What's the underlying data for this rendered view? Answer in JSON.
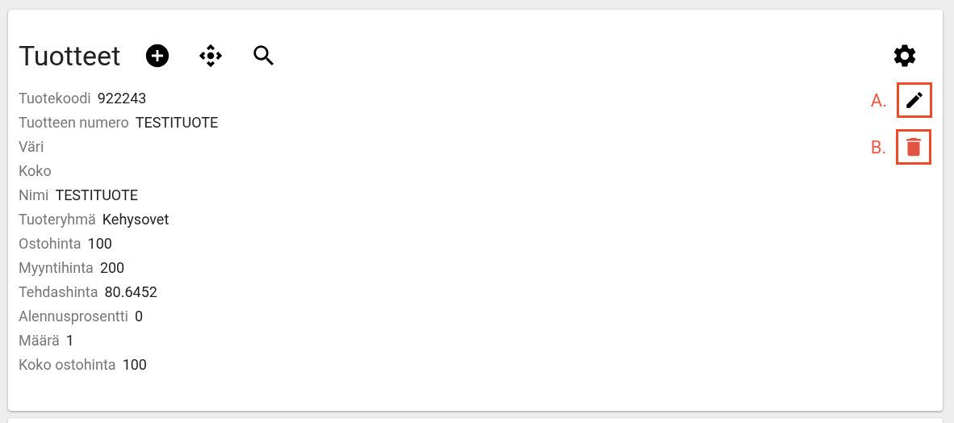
{
  "card": {
    "title": "Tuotteet"
  },
  "fields": [
    {
      "label": "Tuotekoodi",
      "value": "922243"
    },
    {
      "label": "Tuotteen numero",
      "value": "TESTITUOTE"
    },
    {
      "label": "Väri"
    },
    {
      "label": "Koko"
    },
    {
      "label": "Nimi",
      "value": "TESTITUOTE"
    },
    {
      "label": "Tuoteryhmä",
      "value": "Kehysovet"
    },
    {
      "label": "Ostohinta",
      "value": "100"
    },
    {
      "label": "Myyntihinta",
      "value": "200"
    },
    {
      "label": "Tehdashinta",
      "value": "80.6452"
    },
    {
      "label": "Alennusprosentti",
      "value": "0"
    },
    {
      "label": "Määrä",
      "value": "1"
    },
    {
      "label": "Koko ostohinta",
      "value": "100"
    }
  ],
  "actions": [
    {
      "kind": "edit",
      "callout": "A."
    },
    {
      "kind": "delete",
      "callout": "B."
    }
  ]
}
